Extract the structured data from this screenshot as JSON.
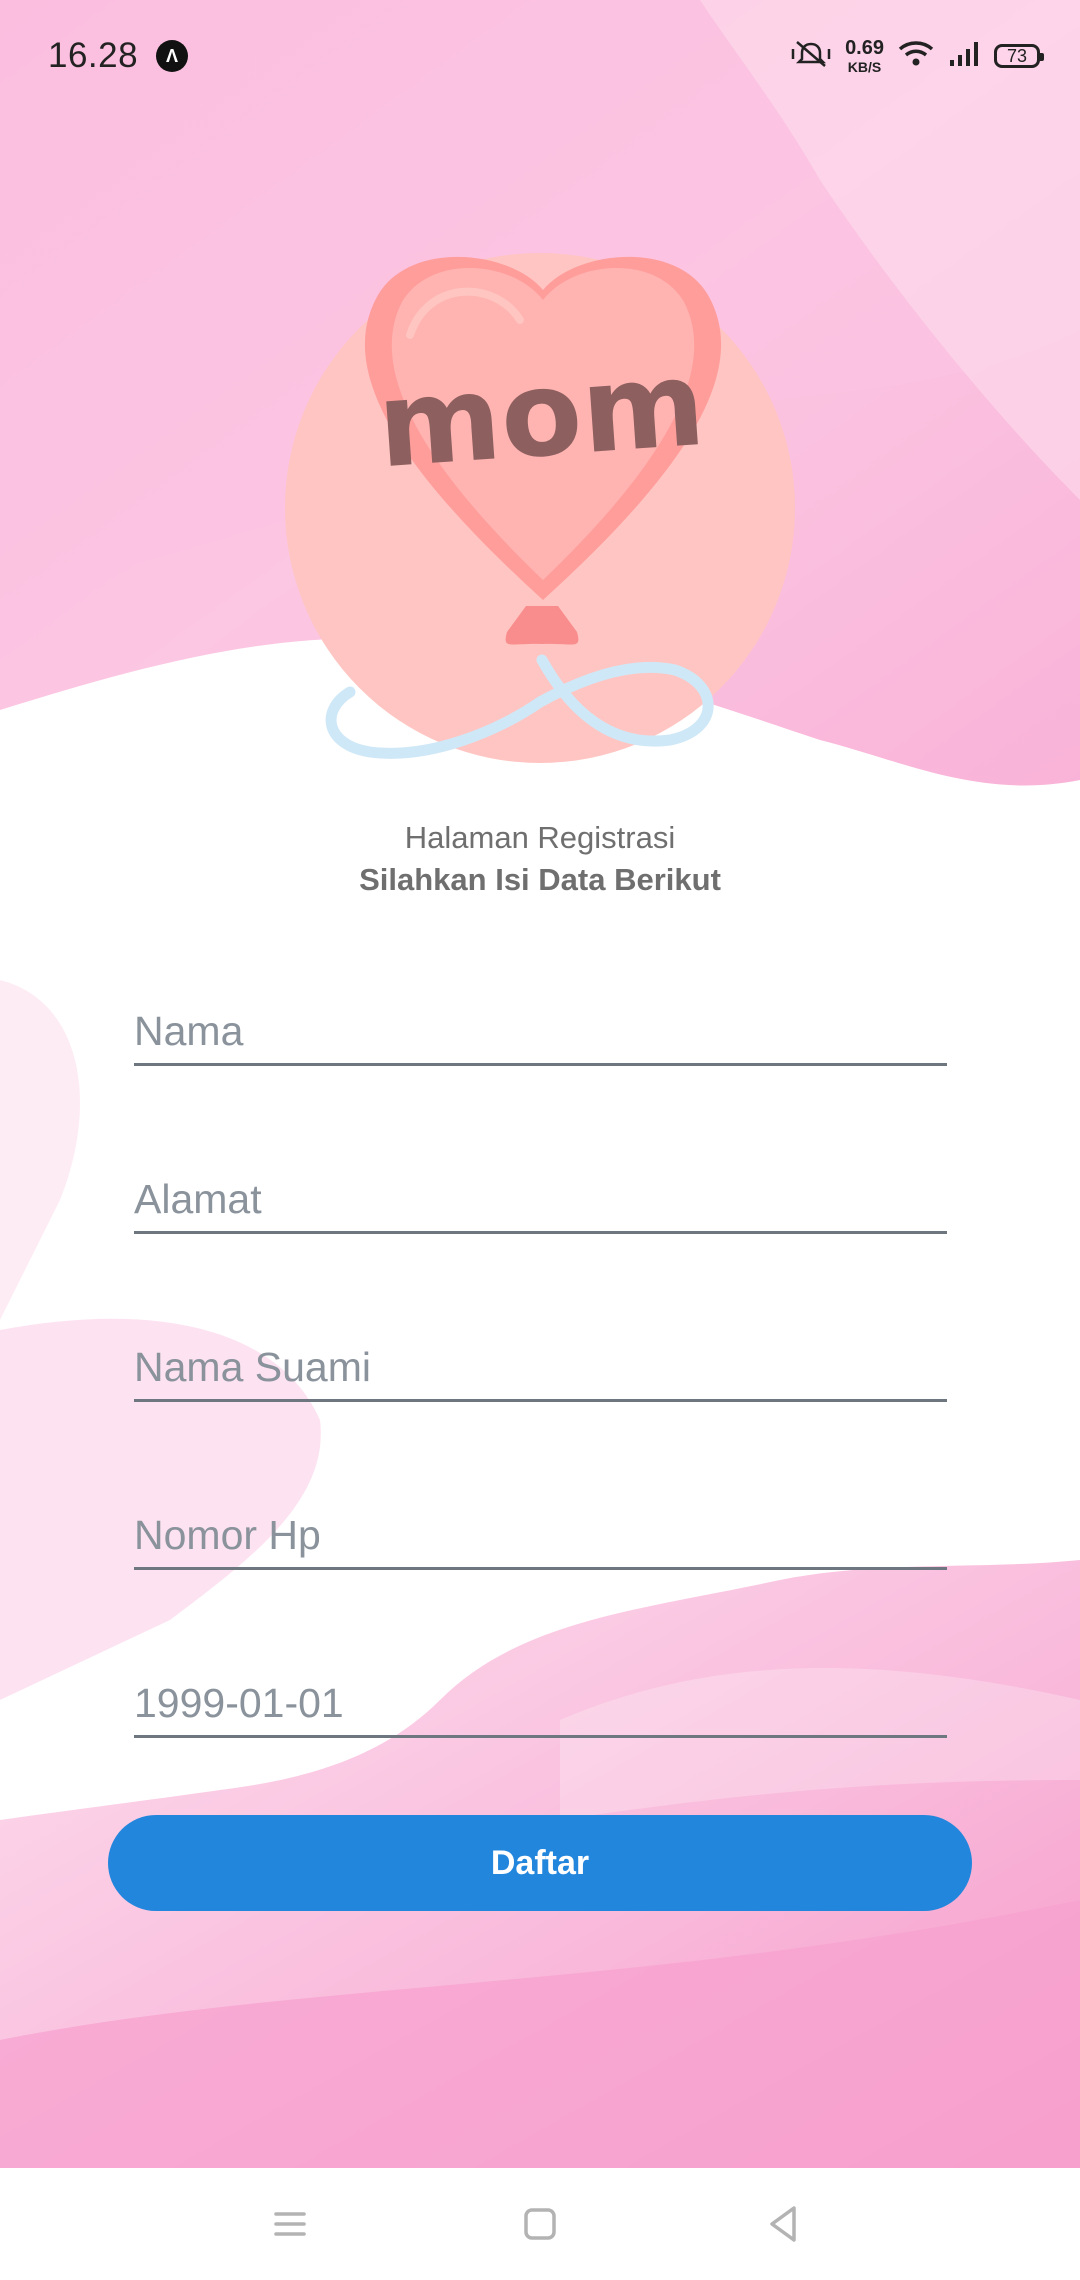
{
  "status_bar": {
    "time": "16.28",
    "app_icon_glyph": "Λ",
    "speed_value": "0.69",
    "speed_unit": "KB/S",
    "battery": "73",
    "icons": [
      "silent-vibrate-icon",
      "wifi-icon",
      "signal-icon",
      "battery-icon"
    ]
  },
  "logo": {
    "text": "mom"
  },
  "header": {
    "title": "Halaman Registrasi",
    "subtitle": "Silahkan Isi Data Berikut"
  },
  "form": {
    "fields": [
      {
        "name": "nama",
        "placeholder": "Nama",
        "value": ""
      },
      {
        "name": "alamat",
        "placeholder": "Alamat",
        "value": ""
      },
      {
        "name": "nama_suami",
        "placeholder": "Nama Suami",
        "value": ""
      },
      {
        "name": "nomor_hp",
        "placeholder": "Nomor Hp",
        "value": ""
      },
      {
        "name": "tanggal_lahir",
        "placeholder": "1999-01-01",
        "value": ""
      }
    ],
    "submit_label": "Daftar"
  },
  "nav_bar": {
    "icons": [
      "menu-icon",
      "home-icon",
      "back-icon"
    ]
  },
  "colors": {
    "accent": "#2386dd",
    "pink": "#f8a8d3",
    "balloon": "#ffb0ae",
    "underline": "#6e7680"
  }
}
